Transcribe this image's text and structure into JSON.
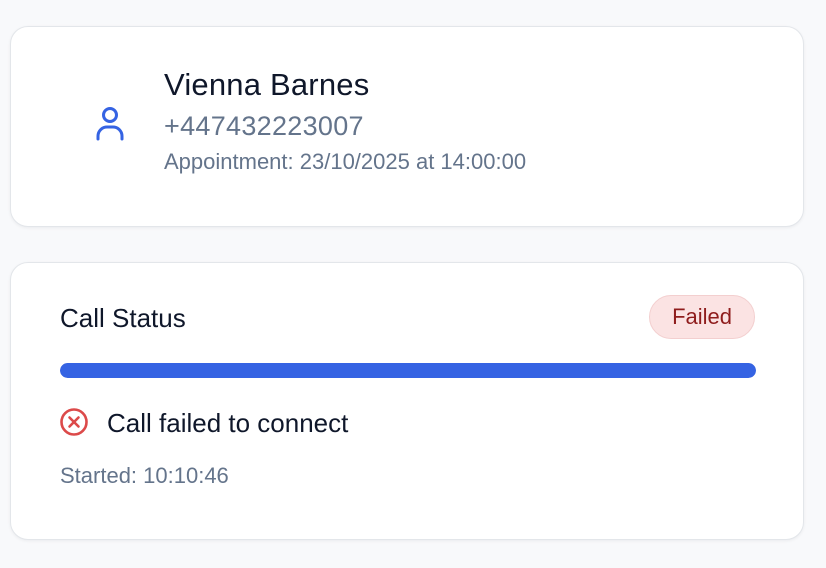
{
  "contact": {
    "icon": "user-icon",
    "name": "Vienna Barnes",
    "phone": "+447432223007",
    "appointment": "Appointment: 23/10/2025 at 14:00:00"
  },
  "call_status": {
    "title": "Call Status",
    "badge": "Failed",
    "progress": 1.0,
    "message_icon": "x-circle-icon",
    "message": "Call failed to connect",
    "started": "Started: 10:10:46"
  },
  "colors": {
    "accent": "#3563e3",
    "badge_bg": "#fbe3e3",
    "badge_text": "#8f1d1d",
    "error_icon": "#dc4a4a",
    "muted_text": "#64748b",
    "primary_text": "#0f172a"
  }
}
